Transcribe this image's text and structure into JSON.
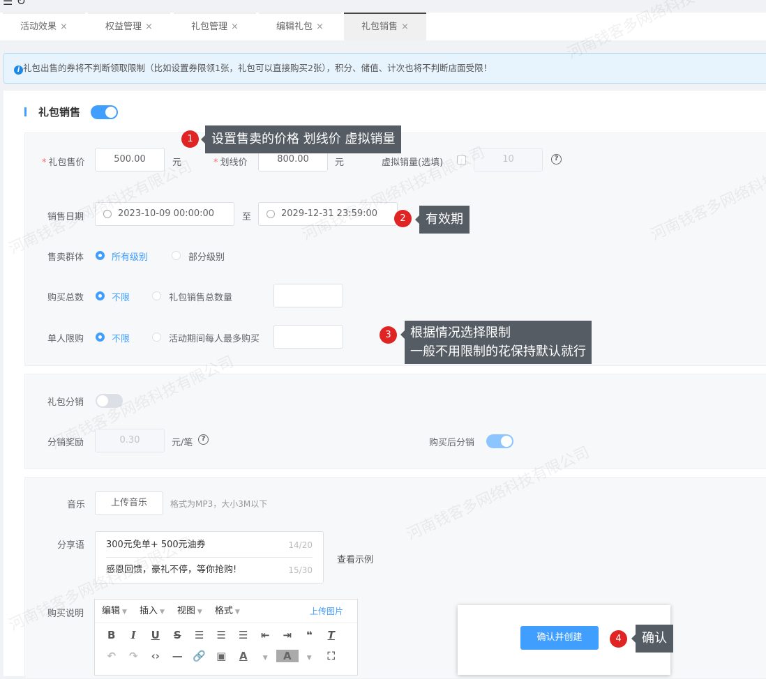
{
  "top_icons": {
    "menu": "☰",
    "refresh": "↻"
  },
  "tabs": [
    {
      "label": "活动效果"
    },
    {
      "label": "权益管理"
    },
    {
      "label": "礼包管理"
    },
    {
      "label": "编辑礼包"
    },
    {
      "label": "礼包销售",
      "active": true
    }
  ],
  "tab_close": "×",
  "alert": "礼包出售的券将不判断领取限制（比如设置券限领1张，礼包可以直接购买2张），积分、储值、计次也将不判断店面受限！",
  "section_title": "礼包销售",
  "section_toggle_on": true,
  "price": {
    "label": "礼包售价",
    "value": "500.00",
    "unit": "元"
  },
  "strike": {
    "label": "划线价",
    "value": "800.00",
    "unit": "元"
  },
  "virtual_sales": {
    "label": "虚拟销量(选填)",
    "value": "10",
    "checked": false
  },
  "sale_date": {
    "label": "销售日期",
    "start": "2023-10-09 00:00:00",
    "to": "至",
    "end": "2029-12-31 23:59:00"
  },
  "group": {
    "label": "售卖群体",
    "options": [
      "所有级别",
      "部分级别"
    ],
    "selected": "所有级别"
  },
  "total": {
    "label": "购买总数",
    "options": [
      "不限",
      "礼包销售总数量"
    ],
    "selected": "不限"
  },
  "per_user": {
    "label": "单人限购",
    "options": [
      "不限",
      "活动期间每人最多购买"
    ],
    "selected": "不限"
  },
  "distribution": {
    "label": "礼包分销",
    "enabled": false,
    "reward_label": "分销奖励",
    "reward_value": "0.30",
    "reward_unit": "元/笔",
    "after_label": "购买后分销",
    "after_enabled": true
  },
  "music": {
    "label": "音乐",
    "button": "上传音乐",
    "hint": "格式为MP3，大小3M以下"
  },
  "share": {
    "label": "分享语",
    "lines": [
      {
        "text": "300元免单+ 500元油券",
        "count": "14/20"
      },
      {
        "text": "感恩回馈，豪礼不停，等你抢购!",
        "count": "15/30"
      }
    ],
    "example": "查看示例"
  },
  "desc": {
    "label": "购买说明",
    "menus": [
      "编辑",
      "插入",
      "视图",
      "格式"
    ],
    "upload": "上传图片"
  },
  "confirm_button": "确认并创建",
  "callouts": [
    {
      "num": "1",
      "text": "设置售卖的价格  划线价  虚拟销量"
    },
    {
      "num": "2",
      "text": "有效期"
    },
    {
      "num": "3",
      "line1": "根据情况选择限制",
      "line2": "一般不用限制的花保持默认就行"
    },
    {
      "num": "4",
      "text": "确认"
    }
  ],
  "watermark": "河南钱客多网络科技有限公司"
}
